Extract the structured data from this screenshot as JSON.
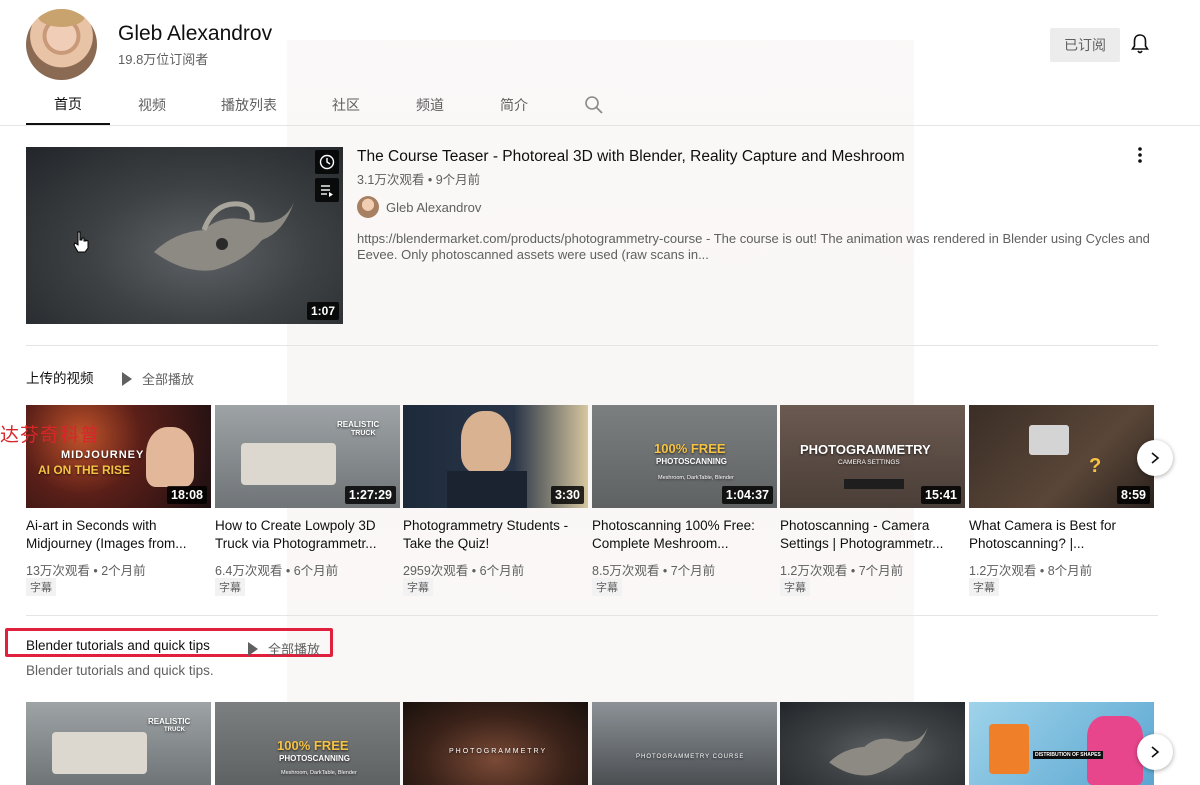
{
  "channel": {
    "name": "Gleb Alexandrov",
    "subscribers": "19.8万位订阅者",
    "subscribe_label": "已订阅"
  },
  "tabs": [
    "首页",
    "视频",
    "播放列表",
    "社区",
    "频道",
    "简介"
  ],
  "featured": {
    "title": "The Course Teaser - Photoreal 3D with Blender, Reality Capture and Meshroom",
    "meta": "3.1万次观看 • 9个月前",
    "author": "Gleb Alexandrov",
    "description": "https://blendermarket.com/products/photogrammetry-course - The course is out! The animation was rendered in Blender using Cycles and Eevee. Only photoscanned assets were used (raw scans in...",
    "duration": "1:07"
  },
  "uploads": {
    "title": "上传的视频",
    "play_all": "全部播放",
    "videos": [
      {
        "title": "Ai-art in Seconds with Midjourney (Images from...",
        "meta": "13万次观看 • 2个月前",
        "cc": "字幕",
        "duration": "18:08",
        "overlay": [
          "MIDJOURNEY",
          "AI ON THE RISE"
        ]
      },
      {
        "title": "How to Create Lowpoly 3D Truck via Photogrammetr...",
        "meta": "6.4万次观看 • 6个月前",
        "cc": "字幕",
        "duration": "1:27:29",
        "overlay": [
          "REALISTIC",
          "TRUCK"
        ]
      },
      {
        "title": "Photogrammetry Students - Take the Quiz!",
        "meta": "2959次观看 • 6个月前",
        "cc": "字幕",
        "duration": "3:30",
        "overlay": []
      },
      {
        "title": "Photoscanning 100% Free: Complete Meshroom...",
        "meta": "8.5万次观看 • 7个月前",
        "cc": "字幕",
        "duration": "1:04:37",
        "overlay": [
          "100% FREE",
          "PHOTOSCANNING",
          "Meshroom, DarkTable, Blender"
        ]
      },
      {
        "title": "Photoscanning - Camera Settings | Photogrammetr...",
        "meta": "1.2万次观看 • 7个月前",
        "cc": "字幕",
        "duration": "15:41",
        "overlay": [
          "PHOTOGRAMMETRY",
          "CAMERA SETTINGS"
        ]
      },
      {
        "title": "What Camera is Best for Photoscanning? |...",
        "meta": "1.2万次观看 • 8个月前",
        "cc": "字幕",
        "duration": "8:59",
        "overlay": []
      }
    ]
  },
  "tutorials": {
    "title": "Blender tutorials and quick tips",
    "play_all": "全部播放",
    "subtitle": "Blender tutorials and quick tips.",
    "overlays": [
      [
        "REALISTIC",
        "TRUCK"
      ],
      [
        "100% FREE",
        "PHOTOSCANNING",
        "Meshroom, DarkTable, Blender"
      ],
      [
        "PHOTOGRAMMETRY"
      ],
      [
        "PHOTOGRAMMETRY COURSE"
      ],
      [],
      [
        "DISTRIBUTION OF SHAPES"
      ]
    ]
  },
  "watermark": "达芬奇科普",
  "colors": {
    "highlight_box": "#e0203c",
    "subscribed_bg": "#ececec",
    "text_secondary": "#606060"
  }
}
